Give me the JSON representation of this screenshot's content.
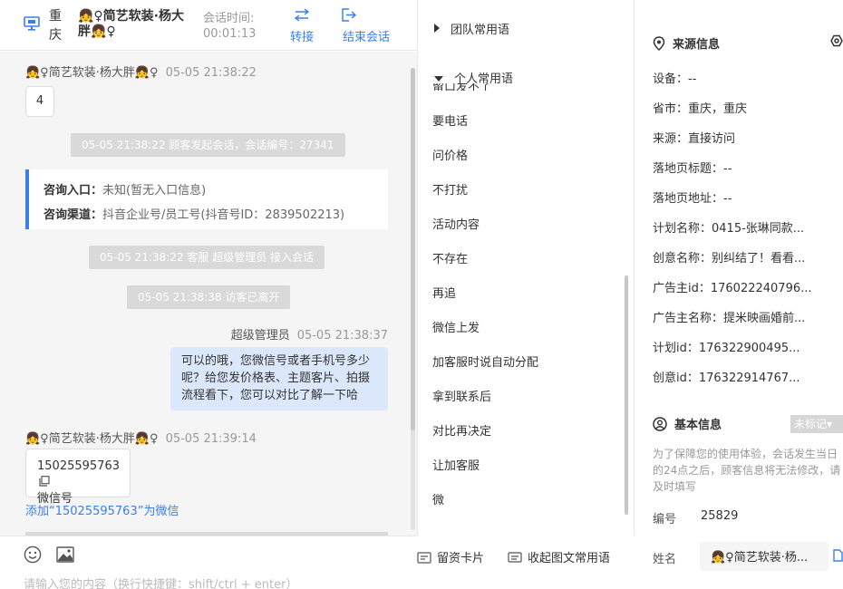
{
  "header": {
    "city": "重庆",
    "customer_name": "👧♀简艺软装·杨大胖👧♀",
    "session_time_label": "会话时间:",
    "session_time_value": "00:01:13",
    "transfer_label": "转接",
    "end_label": "结束会话"
  },
  "chat": {
    "msg1": {
      "sender": "👧♀简艺软装·杨大胖👧♀",
      "timestamp": "05-05 21:38:22",
      "text": "4"
    },
    "system_start": "05-05 21:38:22 顾客发起会话，会话编号：27341",
    "consult": {
      "entry_label": "咨询入口：",
      "entry_value": "未知(暂无入口信息)",
      "channel_label": "咨询渠道：",
      "channel_value": "抖音企业号/员工号(抖音号ID：2839502213)"
    },
    "system_join": "05-05 21:38:22 客服 超级管理员 接入会话",
    "system_leave": "05-05 21:38:38 访客已离开",
    "agent_msg": {
      "sender": "超级管理员",
      "timestamp": "05-05 21:38:37",
      "text": "可以的哦，您微信号或者手机号多少呢？给您发价格表、主题客片、拍摄流程看下，您可以对比了解一下哈"
    },
    "msg2": {
      "sender": "👧♀简艺软装·杨大胖👧♀",
      "timestamp": "05-05 21:39:14",
      "phone": "15025595763",
      "caption": "微信号"
    },
    "add_wechat_link": "添加“15025595763”为微信"
  },
  "input_bar": {
    "lead_card_label": "留资卡片",
    "collapse_label": "收起图文常用语",
    "placeholder": "请输入您的内容（换行快捷键：shift/ctrl + enter）"
  },
  "phrases": {
    "team_group": "团队常用语",
    "personal_group": "个人常用语",
    "cut_item": "留口发不了",
    "items": [
      "要电话",
      "问价格",
      "不打扰",
      "活动内容",
      "不存在",
      "再追",
      "微信上发",
      "加客服时说自动分配",
      "拿到联系后",
      "对比再决定",
      "让加客服",
      "微"
    ]
  },
  "source_info": {
    "title": "来源信息",
    "rows": [
      "设备：--",
      "省市：重庆，重庆",
      "来源：直接访问",
      "落地页标题：--",
      "落地页地址：--",
      "计划名称：0415-张琳同款...",
      "创意名称：别纠结了！看看...",
      "广告主id：176022240796...",
      "广告主名称：提米映画婚前...",
      "计划id：176322900495...",
      "创意id：176322914767..."
    ]
  },
  "basic_info": {
    "title": "基本信息",
    "tag_label": "未标记▾",
    "notice": "为了保障您的使用体验，会话发生当日的24点之后，顾客信息将无法修改，请及时填写",
    "id_label": "编号",
    "id_value": "25829",
    "name_label": "姓名",
    "name_value": "👧♀简艺软装·杨..."
  },
  "colors": {
    "accent": "#3a7ee8",
    "chat_bg": "#f5f5f5",
    "agent_bubble": "#dbe8fc",
    "system_bg": "#d9d9d9"
  }
}
